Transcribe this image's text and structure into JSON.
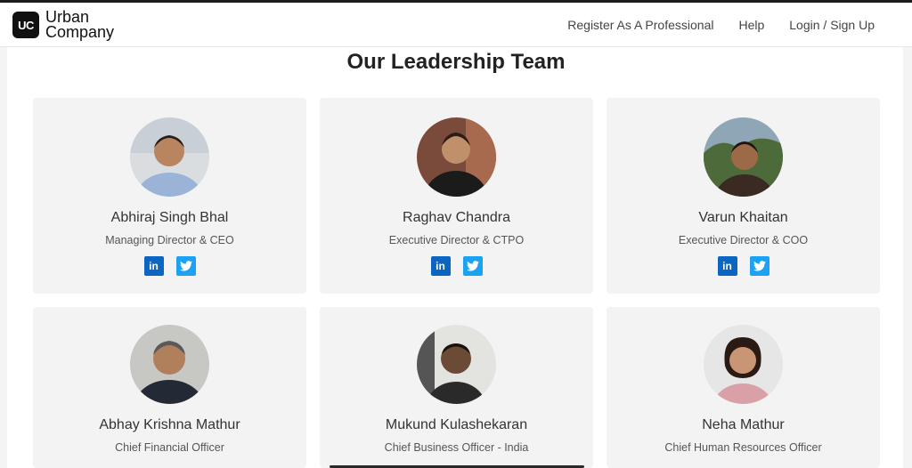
{
  "header": {
    "logo_badge": "UC",
    "logo_line1": "Urban",
    "logo_line2": "Company",
    "nav": [
      "Register As A Professional",
      "Help",
      "Login / Sign Up"
    ]
  },
  "section_title": "Our Leadership Team",
  "leaders": [
    {
      "name": "Abhiraj Singh Bhal",
      "role": "Managing Director & CEO"
    },
    {
      "name": "Raghav Chandra",
      "role": "Executive Director & CTPO"
    },
    {
      "name": "Varun Khaitan",
      "role": "Executive Director & COO"
    },
    {
      "name": "Abhay Krishna Mathur",
      "role": "Chief Financial Officer"
    },
    {
      "name": "Mukund Kulashekaran",
      "role": "Chief Business Officer - India"
    },
    {
      "name": "Neha Mathur",
      "role": "Chief Human Resources Officer"
    }
  ],
  "social": {
    "linkedin_glyph": "in",
    "twitter_glyph": "🐦"
  },
  "colors": {
    "linkedin": "#0a66c2",
    "twitter": "#1da1f2",
    "card_bg": "#f3f3f3"
  }
}
